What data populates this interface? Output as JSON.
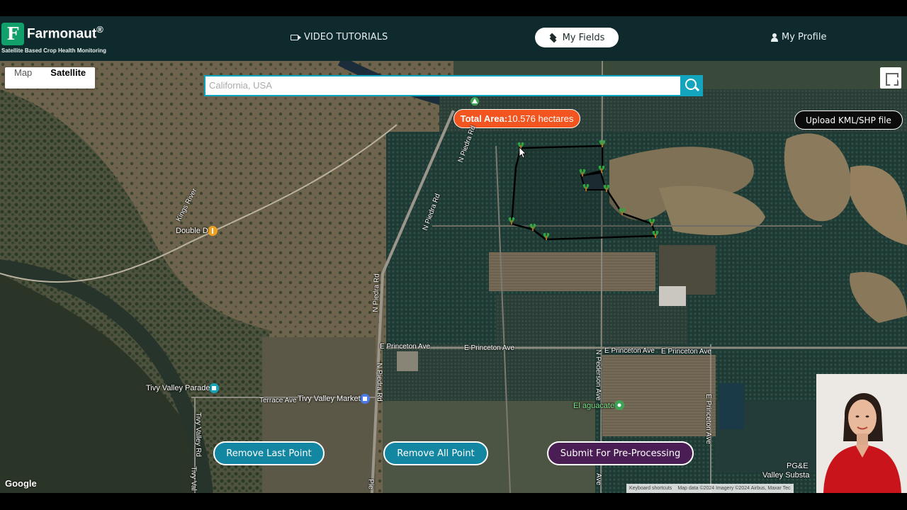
{
  "header": {
    "brand_name": "Farmonaut",
    "brand_registered": "®",
    "brand_tagline": "Satellite Based Crop Health Monitoring",
    "nav_video": "VIDEO TUTORIALS",
    "nav_fields": "My Fields",
    "nav_profile": "My Profile"
  },
  "map_controls": {
    "map_label": "Map",
    "satellite_label": "Satellite",
    "search_placeholder": "California, USA",
    "upload_label": "Upload KML/SHP file"
  },
  "field": {
    "total_area_label": "Total Area:",
    "total_area_value": "10.576 hectares"
  },
  "actions": {
    "remove_last": "Remove Last Point",
    "remove_all": "Remove All Point",
    "submit": "Submit For Pre-Processing"
  },
  "map_labels": {
    "kings_river": "Kings River",
    "double_d": "Double D",
    "n_piedra_rd_1": "N Piedra Rd",
    "n_piedra_rd_2": "N Piedra Rd",
    "n_piedra_rd_3": "N Piedra Rd",
    "n_piedra_rd_4": "N Piedra Rd",
    "princeton_1": "E Princeton Ave",
    "princeton_2": "E Princeton Ave",
    "princeton_3": "E Princeton Ave",
    "princeton_4": "E Princeton Ave",
    "princeton_vertical": "E Princeton Ave",
    "n_pederson": "N Pederson Ave",
    "pederson_short": "Ave",
    "tivy_valley_parade": "Tivy Valley Parade",
    "terrace_ave": "Terrace Ave",
    "tivy_valley_market": "Tivy Valley Market",
    "tivy_valley_rd": "Tivy Valley Rd",
    "tivy_val": "Tivy Val",
    "el_aguacate": "El aguacate",
    "pge_line1": "PG&E",
    "pge_line2": "Valley Substa",
    "piedra_short": "Pie"
  },
  "attribution": {
    "google": "Google",
    "shortcuts": "Keyboard shortcuts",
    "map_data": "Map data ©2024 Imagery ©2024 Airbus, Maxar Tec"
  },
  "colors": {
    "header_bg": "#0f2a2c",
    "search_accent": "#0aa6c0",
    "total_area_bg": "#f2551f",
    "teal_button": "#1386a1",
    "purple_button": "#4a1d55"
  }
}
